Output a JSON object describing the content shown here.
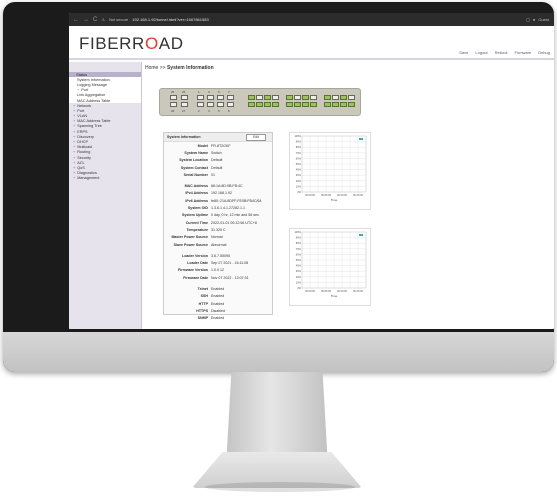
{
  "browser": {
    "nav": [
      "←",
      "→",
      "C"
    ],
    "security": "Not secure",
    "url": "192.168.1.92/tunnel.html?ver=1667861583",
    "right_label": "Guest"
  },
  "header": {
    "logo_main": "FIBERR",
    "logo_accent": "O",
    "logo_tail": "AD",
    "links": [
      "Save",
      "Logout",
      "Reboot",
      "Firmware",
      "Debug"
    ]
  },
  "breadcrumb": {
    "home": "Home",
    "sep": ">>",
    "current": "System Information"
  },
  "sidebar": {
    "items": [
      {
        "label": "Status",
        "toggle": "-",
        "kind": "active"
      },
      {
        "label": "System Information",
        "kind": "sub"
      },
      {
        "label": "Logging Message",
        "kind": "sub"
      },
      {
        "label": "Port",
        "toggle": "+",
        "kind": "sub"
      },
      {
        "label": "Link Aggregation",
        "kind": "sub"
      },
      {
        "label": "MAC Address Table",
        "kind": "sub"
      },
      {
        "label": "Network",
        "toggle": "+"
      },
      {
        "label": "Port",
        "toggle": "+"
      },
      {
        "label": "VLAN",
        "toggle": "+"
      },
      {
        "label": "MAC Address Table",
        "toggle": "+"
      },
      {
        "label": "Spanning Tree",
        "toggle": "+"
      },
      {
        "label": "ERPS",
        "toggle": "+"
      },
      {
        "label": "Discovery",
        "toggle": "+"
      },
      {
        "label": "DHCP",
        "toggle": "+"
      },
      {
        "label": "Multicast",
        "toggle": "+"
      },
      {
        "label": "Routing",
        "toggle": "+"
      },
      {
        "label": "Security",
        "toggle": "+"
      },
      {
        "label": "ACL",
        "toggle": "+"
      },
      {
        "label": "QoS",
        "toggle": "+"
      },
      {
        "label": "Diagnostics",
        "toggle": "+"
      },
      {
        "label": "Management",
        "toggle": "+"
      }
    ]
  },
  "ports": {
    "top_numbers": [
      "25",
      "26",
      "1",
      "3",
      "5",
      "7"
    ],
    "bottom_numbers": [
      "26",
      "27",
      "2",
      "4",
      "6",
      "8"
    ]
  },
  "system_info": {
    "title": "System Information",
    "edit_label": "Edit",
    "groups": [
      [
        {
          "k": "Model",
          "v": "FR-8T2GKF"
        },
        {
          "k": "System Name",
          "v": "Switch"
        },
        {
          "k": "System Location",
          "v": "Default"
        },
        {
          "k": "System Contact",
          "v": "Default"
        },
        {
          "k": "Serial Number",
          "v": "01"
        }
      ],
      [
        {
          "k": "MAC Address",
          "v": "68:1A:8D:0B:FB:4C"
        },
        {
          "k": "IPv4 Address",
          "v": "192.168.1.92"
        },
        {
          "k": "IPv6 Address",
          "v": "fe80::21A:8DFF:FE0B:FB4C/64"
        },
        {
          "k": "System OID",
          "v": "1.3.6.1.4.1.27282.1.1"
        },
        {
          "k": "System Uptime",
          "v": "0 day, 0 hr, 12 min and 56 sec"
        },
        {
          "k": "Current Time",
          "v": "2022-01-01 00:12:56 UTC+8"
        },
        {
          "k": "Temperature",
          "v": "31.325 C"
        },
        {
          "k": "Master Power Source",
          "v": "Normal"
        },
        {
          "k": "Slave Power Source",
          "v": "Abnormal"
        }
      ],
      [
        {
          "k": "Loader Version",
          "v": "3.6.7.55095"
        },
        {
          "k": "Loader Date",
          "v": "Sep 27 2021 - 16:11:08"
        },
        {
          "k": "Firmware Version",
          "v": "1.0.0.12"
        },
        {
          "k": "Firmware Date",
          "v": "Nov 07 2022 - 13:07:31"
        }
      ],
      [
        {
          "k": "Telnet",
          "v": "Enabled"
        },
        {
          "k": "SSH",
          "v": "Enabled"
        },
        {
          "k": "HTTP",
          "v": "Enabled"
        },
        {
          "k": "HTTPS",
          "v": "Disabled"
        },
        {
          "k": "SNMP",
          "v": "Enabled"
        }
      ]
    ]
  },
  "chart_data": [
    {
      "type": "line",
      "xlabel": "Time",
      "x": [
        "00:00:00",
        "00:05:00",
        "00:10:00",
        "00:15:00"
      ],
      "y_ticks": [
        "100%",
        "90%",
        "80%",
        "70%",
        "60%",
        "50%",
        "40%",
        "30%",
        "20%",
        "10%",
        "0%"
      ],
      "ylim": [
        0,
        100
      ],
      "grid": true,
      "legend": "top-right",
      "series_color": "#4aa3c8"
    },
    {
      "type": "line",
      "xlabel": "Time",
      "x": [
        "00:00:00",
        "00:05:00",
        "00:10:00",
        "00:15:00"
      ],
      "y_ticks": [
        "100%",
        "90%",
        "80%",
        "70%",
        "60%",
        "50%",
        "40%",
        "30%",
        "20%",
        "10%",
        "0%"
      ],
      "ylim": [
        0,
        100
      ],
      "grid": true,
      "legend": "top-right",
      "series_color": "#4aa3c8"
    }
  ]
}
